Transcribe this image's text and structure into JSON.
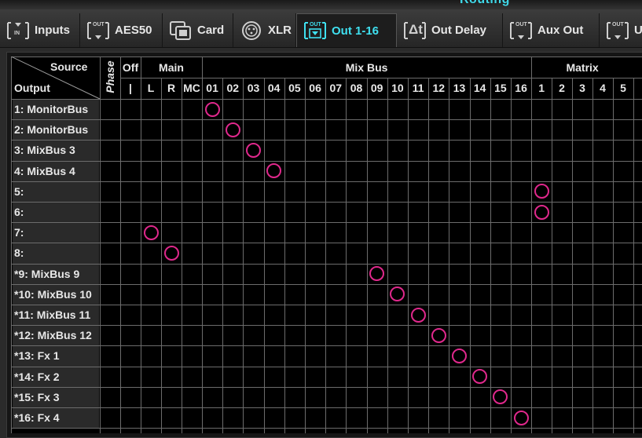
{
  "window": {
    "title": "Routing"
  },
  "tabs": [
    {
      "label": "Inputs",
      "icon": "in-port-icon",
      "badge": "IN",
      "active": false
    },
    {
      "label": "AES50",
      "icon": "out-port-icon",
      "badge": "OUT",
      "active": false
    },
    {
      "label": "Card",
      "icon": "card-icon",
      "badge": "",
      "active": false
    },
    {
      "label": "XLR",
      "icon": "xlr-connector-icon",
      "badge": "",
      "active": false
    },
    {
      "label": "Out 1-16",
      "icon": "out-port-icon",
      "badge": "OUT",
      "active": true
    },
    {
      "label": "Out Delay",
      "icon": "delay-icon",
      "badge": "Δt",
      "active": false
    },
    {
      "label": "Aux Out",
      "icon": "out-port-icon",
      "badge": "OUT",
      "active": false
    },
    {
      "label": "U",
      "icon": "out-port-icon",
      "badge": "OUT",
      "active": false
    }
  ],
  "matrix": {
    "corner_source": "Source",
    "corner_output": "Output",
    "phase_label": "Phase",
    "groups": [
      {
        "label": "Off",
        "columns": [
          "|"
        ]
      },
      {
        "label": "Main",
        "columns": [
          "L",
          "R",
          "MC"
        ]
      },
      {
        "label": "Mix Bus",
        "columns": [
          "01",
          "02",
          "03",
          "04",
          "05",
          "06",
          "07",
          "08",
          "09",
          "10",
          "11",
          "12",
          "13",
          "14",
          "15",
          "16"
        ]
      },
      {
        "label": "Matrix",
        "columns": [
          "1",
          "2",
          "3",
          "4",
          "5"
        ]
      }
    ],
    "rows": [
      {
        "label": "1: MonitorBus",
        "route": "01"
      },
      {
        "label": "2: MonitorBus",
        "route": "02"
      },
      {
        "label": "3: MixBus 3",
        "route": "03"
      },
      {
        "label": "4: MixBus 4",
        "route": "04"
      },
      {
        "label": "5:",
        "route": "1"
      },
      {
        "label": "6:",
        "route": "1"
      },
      {
        "label": "7:",
        "route": "L"
      },
      {
        "label": "8:",
        "route": "R"
      },
      {
        "label": "*9: MixBus 9",
        "route": "09"
      },
      {
        "label": "*10: MixBus 10",
        "route": "10"
      },
      {
        "label": "*11: MixBus 11",
        "route": "11"
      },
      {
        "label": "*12: MixBus 12",
        "route": "12"
      },
      {
        "label": "*13: Fx 1",
        "route": "13"
      },
      {
        "label": "*14: Fx 2",
        "route": "14"
      },
      {
        "label": "*15: Fx 3",
        "route": "15"
      },
      {
        "label": "*16: Fx 4",
        "route": "16"
      }
    ]
  },
  "colors": {
    "accent": "#3fe0f0",
    "route_marker": "#e0288c",
    "grid_line": "#6c6c6c"
  }
}
